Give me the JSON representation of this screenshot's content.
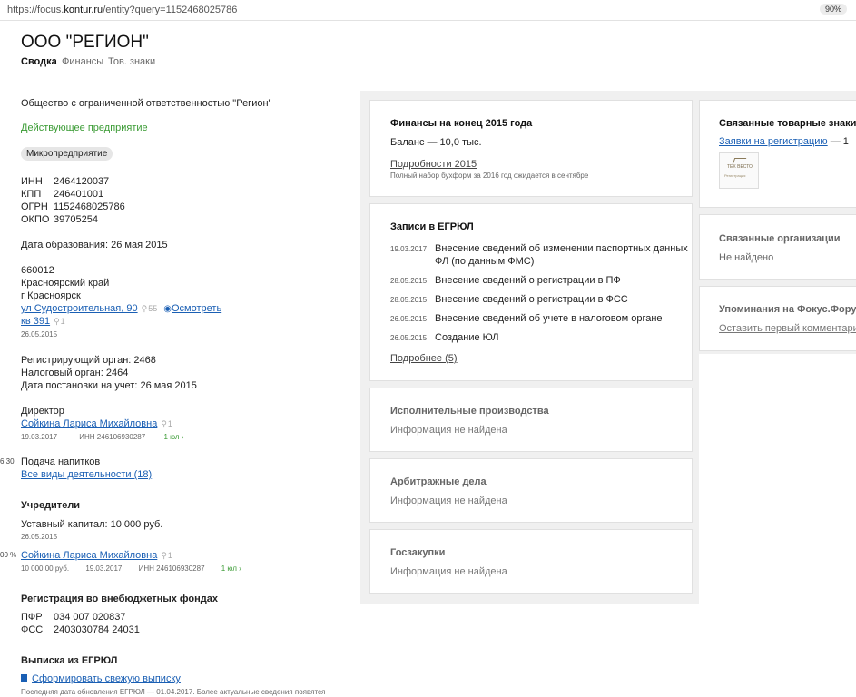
{
  "browser": {
    "url_prefix": "https://focus.",
    "url_host": "kontur.ru",
    "url_path": "/entity?query=1152468025786",
    "zoom": "90%"
  },
  "header": {
    "title": "ООО \"РЕГИОН\"",
    "tabs": [
      "Сводка",
      "Финансы",
      "Тов. знаки"
    ]
  },
  "summary": {
    "full_name": "Общество с ограниченной ответственностью \"Регион\"",
    "status": "Действующее предприятие",
    "badge": "Микропредприятие",
    "ids": [
      {
        "label": "ИНН",
        "value": "2464120037"
      },
      {
        "label": "КПП",
        "value": "246401001"
      },
      {
        "label": "ОГРН",
        "value": "1152468025786"
      },
      {
        "label": "ОКПО",
        "value": "39705254"
      }
    ],
    "founded": "Дата образования: 26 мая 2015",
    "address": {
      "zip": "660012",
      "region": "Красноярский край",
      "city": "г Красноярск",
      "street": "ул Судостроительная, 90",
      "street_count": "55",
      "inspect": "Осмотреть",
      "apt": "кв 391",
      "apt_count": "1",
      "date": "26.05.2015"
    },
    "reg_organ": "Регистрирующий орган: 2468",
    "tax_organ": "Налоговый орган: 2464",
    "tax_date": "Дата постановки на учет: 26 мая 2015",
    "director": {
      "heading": "Директор",
      "name": "Сойкина Лариса Михайловна",
      "count": "1",
      "date": "19.03.2017",
      "inn": "ИНН 246106930287",
      "orgs": "1 юл ›"
    },
    "activity": {
      "edge_code": "6.30",
      "main": "Подача напитков",
      "all_link": "Все виды деятельности (18)"
    },
    "founders": {
      "heading": "Учредители",
      "capital": "Уставный капитал: 10 000 руб.",
      "capital_date": "26.05.2015",
      "edge_pct": "00 %",
      "name": "Сойкина Лариса Михайловна",
      "count": "1",
      "amount": "10 000,00 руб.",
      "date": "19.03.2017",
      "inn": "ИНН 246106930287",
      "orgs": "1 юл ›"
    },
    "funds": {
      "heading": "Регистрация во внебюджетных фондах",
      "items": [
        {
          "label": "ПФР",
          "value": "034 007 020837"
        },
        {
          "label": "ФСС",
          "value": "2403030784 24031"
        }
      ]
    },
    "extract": {
      "heading": "Выписка из ЕГРЮЛ",
      "link": "Сформировать свежую выписку",
      "note": "Последняя дата обновления ЕГРЮЛ — 01.04.2017. Более актуальные сведения появятся"
    }
  },
  "finance_card": {
    "title": "Финансы на конец 2015 года",
    "balance": "Баланс — 10,0 тыс.",
    "details_link": "Подробности 2015",
    "note": "Полный набор бухформ за 2016 год ожидается в сентябре"
  },
  "egrul_card": {
    "title": "Записи в ЕГРЮЛ",
    "records": [
      {
        "date": "19.03.2017",
        "text": "Внесение сведений об изменении паспортных данных",
        "text2": "ФЛ (по данным ФМС)"
      },
      {
        "date": "28.05.2015",
        "text": "Внесение сведений о регистрации в ПФ",
        "text2": ""
      },
      {
        "date": "28.05.2015",
        "text": "Внесение сведений о регистрации в ФСС",
        "text2": ""
      },
      {
        "date": "26.05.2015",
        "text": "Внесение сведений об учете в налоговом органе",
        "text2": ""
      },
      {
        "date": "26.05.2015",
        "text": "Создание ЮЛ",
        "text2": ""
      }
    ],
    "more_link": "Подробнее (5)"
  },
  "exec_card": {
    "title": "Исполнительные производства",
    "text": "Информация не найдена"
  },
  "arb_card": {
    "title": "Арбитражные дела",
    "text": "Информация не найдена"
  },
  "gov_card": {
    "title": "Госзакупки",
    "text": "Информация не найдена"
  },
  "trademarks_card": {
    "title": "Связанные товарные знаки",
    "link": "Заявки на регистрацию",
    "count": "— 1",
    "logo_text1": "ТЕХ ВЕСТО",
    "logo_text2": "Регистрация"
  },
  "related_card": {
    "title": "Связанные организации",
    "text": "Не найдено"
  },
  "forum_card": {
    "title": "Упоминания на Фокус.Форуме",
    "link": "Оставить первый комментарий"
  }
}
